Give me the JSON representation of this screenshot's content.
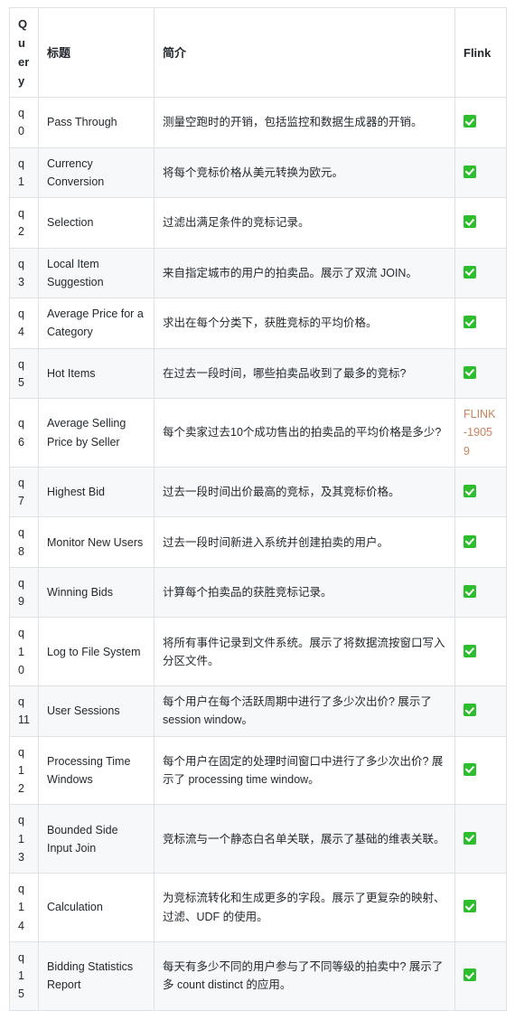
{
  "table": {
    "headers": {
      "query": "Query",
      "title": "标题",
      "description": "简介",
      "flink": "Flink"
    },
    "rows": [
      {
        "query": "q0",
        "title": "Pass Through",
        "description": "测量空跑时的开销，包括监控和数据生成器的开销。",
        "flink_status": "supported",
        "flink_label": ""
      },
      {
        "query": "q1",
        "title": "Currency Conversion",
        "description": "将每个竞标价格从美元转换为欧元。",
        "flink_status": "supported",
        "flink_label": ""
      },
      {
        "query": "q2",
        "title": "Selection",
        "description": "过滤出满足条件的竞标记录。",
        "flink_status": "supported",
        "flink_label": ""
      },
      {
        "query": "q3",
        "title": "Local Item Suggestion",
        "description": "来自指定城市的用户的拍卖品。展示了双流 JOIN。",
        "flink_status": "supported",
        "flink_label": ""
      },
      {
        "query": "q4",
        "title": "Average Price for a Category",
        "description": "求出在每个分类下，获胜竞标的平均价格。",
        "flink_status": "supported",
        "flink_label": ""
      },
      {
        "query": "q5",
        "title": "Hot Items",
        "description": "在过去一段时间，哪些拍卖品收到了最多的竞标?",
        "flink_status": "supported",
        "flink_label": ""
      },
      {
        "query": "q6",
        "title": "Average Selling Price by Seller",
        "description": "每个卖家过去10个成功售出的拍卖品的平均价格是多少?",
        "flink_status": "issue",
        "flink_label": "FLINK-19059"
      },
      {
        "query": "q7",
        "title": "Highest Bid",
        "description": "过去一段时间出价最高的竞标，及其竞标价格。",
        "flink_status": "supported",
        "flink_label": ""
      },
      {
        "query": "q8",
        "title": "Monitor New Users",
        "description": "过去一段时间新进入系统并创建拍卖的用户。",
        "flink_status": "supported",
        "flink_label": ""
      },
      {
        "query": "q9",
        "title": "Winning Bids",
        "description": "计算每个拍卖品的获胜竞标记录。",
        "flink_status": "supported",
        "flink_label": ""
      },
      {
        "query": "q10",
        "title": "Log to File System",
        "description": "将所有事件记录到文件系统。展示了将数据流按窗口写入分区文件。",
        "flink_status": "supported",
        "flink_label": ""
      },
      {
        "query": "q11",
        "title": "User Sessions",
        "description": "每个用户在每个活跃周期中进行了多少次出价? 展示了 session window。",
        "flink_status": "supported",
        "flink_label": ""
      },
      {
        "query": "q12",
        "title": "Processing Time Windows",
        "description": "每个用户在固定的处理时间窗口中进行了多少次出价? 展示了 processing time window。",
        "flink_status": "supported",
        "flink_label": ""
      },
      {
        "query": "q13",
        "title": "Bounded Side Input Join",
        "description": "竞标流与一个静态白名单关联，展示了基础的维表关联。",
        "flink_status": "supported",
        "flink_label": ""
      },
      {
        "query": "q14",
        "title": "Calculation",
        "description": "为竞标流转化和生成更多的字段。展示了更复杂的映射、过滤、UDF 的使用。",
        "flink_status": "supported",
        "flink_label": ""
      },
      {
        "query": "q15",
        "title": "Bidding Statistics Report",
        "description": "每天有多少不同的用户参与了不同等级的拍卖中? 展示了多 count distinct 的应用。",
        "flink_status": "supported",
        "flink_label": ""
      }
    ]
  },
  "colors": {
    "check_green": "#2cbe2c",
    "issue_link": "#c9825c",
    "border": "#dfe2e5",
    "stripe": "#f6f8fa",
    "text": "#24292e"
  }
}
